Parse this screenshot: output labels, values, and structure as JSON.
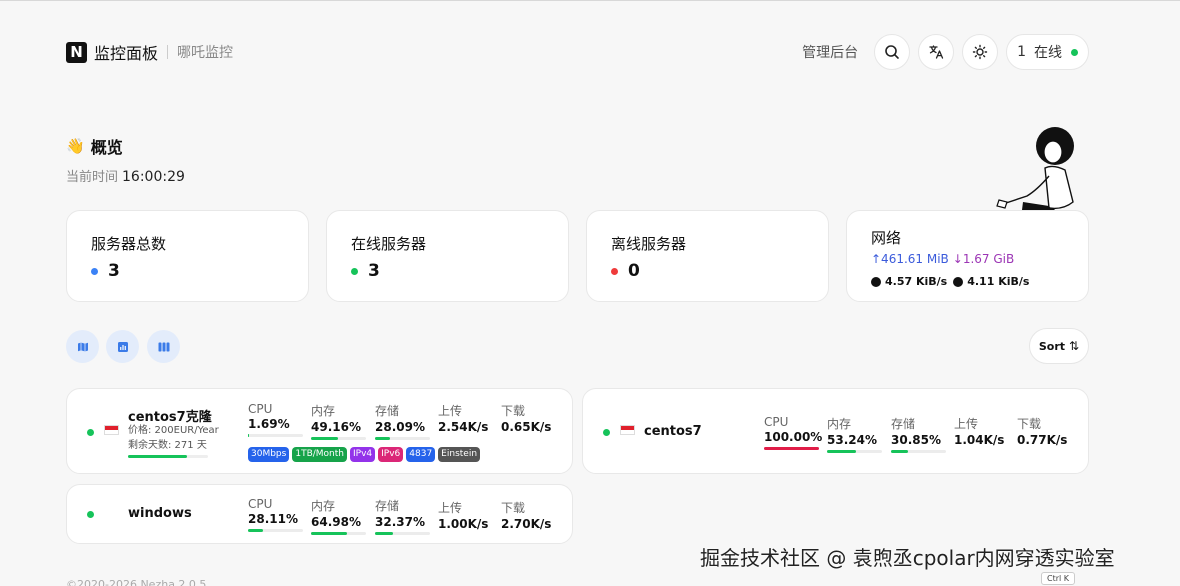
{
  "header": {
    "logo_letter": "N",
    "title": "监控面板",
    "subtitle": "哪吒监控",
    "admin_label": "管理后台",
    "online_count": "1",
    "online_label": "在线"
  },
  "overview": {
    "emoji": "👋",
    "title": "概览",
    "time_label": "当前时间",
    "time_value": "16:00:29"
  },
  "stats": [
    {
      "label": "服务器总数",
      "value": "3",
      "color": "#3b82f6"
    },
    {
      "label": "在线服务器",
      "value": "3",
      "color": "#16c35a"
    },
    {
      "label": "离线服务器",
      "value": "0",
      "color": "#ef3b3b"
    }
  ],
  "network": {
    "label": "网络",
    "upload_total": "↑461.61 MiB",
    "download_total": "↓1.67 GiB",
    "upload_speed": "4.57 KiB/s",
    "download_speed": "4.11 KiB/s"
  },
  "toolbar": {
    "sort_label": "Sort",
    "sort_icon": "⇅"
  },
  "servers": [
    {
      "name": "centos7克隆",
      "price": "价格: 200EUR/Year",
      "remaining": "剩余天数: 271 天",
      "remaining_fraction": 0.74,
      "metrics": {
        "cpu": {
          "label": "CPU",
          "value": "1.69%",
          "percent": 1.69
        },
        "mem": {
          "label": "内存",
          "value": "49.16%",
          "percent": 49.16
        },
        "disk": {
          "label": "存储",
          "value": "28.09%",
          "percent": 28.09
        },
        "up": {
          "label": "上传",
          "value": "2.54K/s"
        },
        "down": {
          "label": "下载",
          "value": "0.65K/s"
        }
      },
      "tags": [
        {
          "text": "30Mbps",
          "color": "#2563eb"
        },
        {
          "text": "1TB/Month",
          "color": "#16a34a"
        },
        {
          "text": "IPv4",
          "color": "#9333ea"
        },
        {
          "text": "IPv6",
          "color": "#db2777"
        },
        {
          "text": "4837",
          "color": "#2563eb"
        },
        {
          "text": "Einstein",
          "color": "#555555"
        }
      ]
    },
    {
      "name": "centos7",
      "metrics": {
        "cpu": {
          "label": "CPU",
          "value": "100.00%",
          "percent": 100
        },
        "mem": {
          "label": "内存",
          "value": "53.24%",
          "percent": 53.24
        },
        "disk": {
          "label": "存储",
          "value": "30.85%",
          "percent": 30.85
        },
        "up": {
          "label": "上传",
          "value": "1.04K/s"
        },
        "down": {
          "label": "下载",
          "value": "0.77K/s"
        }
      }
    },
    {
      "name": "windows",
      "metrics": {
        "cpu": {
          "label": "CPU",
          "value": "28.11%",
          "percent": 28.11
        },
        "mem": {
          "label": "内存",
          "value": "64.98%",
          "percent": 64.98
        },
        "disk": {
          "label": "存储",
          "value": "32.37%",
          "percent": 32.37
        },
        "up": {
          "label": "上传",
          "value": "1.00K/s"
        },
        "down": {
          "label": "下载",
          "value": "2.70K/s"
        }
      }
    }
  ],
  "footer": "©2020-2026 Nezha 2.0.5",
  "shortcut": "Ctrl K",
  "watermark": "掘金技术社区 @ 袁煦丞cpolar内网穿透实验室"
}
